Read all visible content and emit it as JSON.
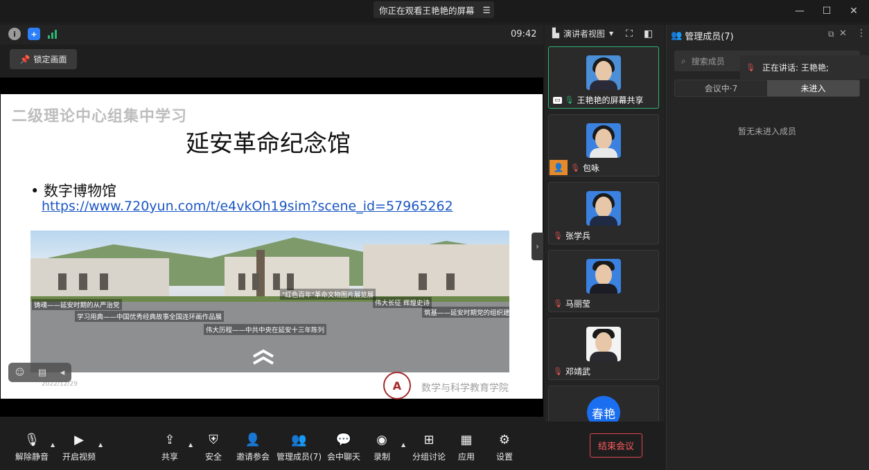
{
  "titlebar": {
    "title": "你正在观看王艳艳的屏幕"
  },
  "infobar": {
    "clock": "09:42"
  },
  "lock_button": {
    "label": "锁定画面"
  },
  "slide": {
    "header": "二级理论中心组集中学习",
    "title": "延安革命纪念馆",
    "bullet": "• 数字博物馆",
    "link": "https://www.720yun.com/t/e4vkOh19sim?scene_id=57965262",
    "date": "2022/12/29",
    "footer": "数学与科学教育学院",
    "image_captions": [
      "铸魂——延安时期的从严治党",
      "学习用典——中国优秀经典故事全国连环画作品展",
      "\"红色百年\"革命文物图片展览展",
      "伟大长征 辉煌史诗",
      "伟大历程——中共中央在延安十三年陈列",
      "筑基——延安时期党的组织建设"
    ]
  },
  "view_toolbar": {
    "label": "演讲者视图"
  },
  "participants": [
    {
      "name": "王艳艳的屏幕共享",
      "active": true,
      "host": false,
      "muted": false
    },
    {
      "name": "包咏",
      "active": false,
      "host": true,
      "muted": true
    },
    {
      "name": "张学兵",
      "active": false,
      "host": false,
      "muted": true
    },
    {
      "name": "马丽莹",
      "active": false,
      "host": false,
      "muted": true
    },
    {
      "name": "邓靖武",
      "active": false,
      "host": false,
      "muted": true
    },
    {
      "name": "春艳",
      "active": false,
      "host": false,
      "muted": false,
      "initials": "春艳"
    }
  ],
  "panel": {
    "title": "管理成员(7)",
    "search_placeholder": "搜索成员",
    "speaking": "正在讲话: 王艳艳;",
    "tabs": [
      "会议中·7",
      "未进入"
    ],
    "empty_message": "暂无未进入成员"
  },
  "toolbar": {
    "unmute": "解除静音",
    "start_video": "开启视频",
    "share": "共享",
    "security": "安全",
    "invite": "邀请参会",
    "manage_members": "管理成员(7)",
    "chat": "会中聊天",
    "record": "录制",
    "breakout": "分组讨论",
    "apps": "应用",
    "settings": "设置",
    "end_meeting": "结束会议"
  }
}
